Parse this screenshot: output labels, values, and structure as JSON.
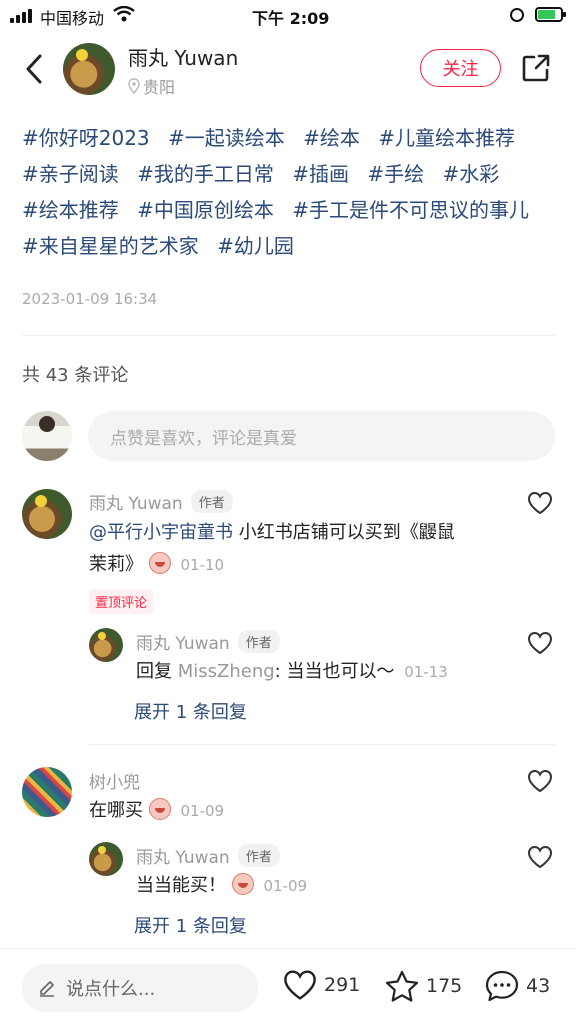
{
  "status_bar": {
    "carrier": "中国移动",
    "time": "下午 2:09"
  },
  "header": {
    "author_name": "雨丸 Yuwan",
    "location": "贵阳",
    "follow_label": "关注"
  },
  "post": {
    "tags": [
      "#你好呀2023",
      "#一起读绘本",
      "#绘本",
      "#儿童绘本推荐",
      "#亲子阅读",
      "#我的手工日常",
      "#插画",
      "#手绘",
      "#水彩",
      "#绘本推荐",
      "#中国原创绘本",
      "#手工是件不可思议的事儿",
      "#来自星星的艺术家",
      "#幼儿园"
    ],
    "date": "2023-01-09 16:34"
  },
  "comments_section": {
    "count_label": "共 43 条评论",
    "input_placeholder": "点赞是喜欢，评论是真爱",
    "comments": [
      {
        "name": "雨丸 Yuwan",
        "badge": "作者",
        "mention": "@平行小宇宙童书",
        "text_line1": " 小红书店铺可以买到《鼹鼠",
        "text_line2": "茉莉》",
        "date": "01-10",
        "pin_label": "置顶评论",
        "reply": {
          "name": "雨丸 Yuwan",
          "badge": "作者",
          "prefix": "回复 ",
          "reply_to": "MissZheng",
          "text": ": 当当也可以～",
          "date": "01-13"
        },
        "expand_label": "展开 1 条回复"
      },
      {
        "name": "树小兜",
        "text": "在哪买",
        "date": "01-09",
        "reply": {
          "name": "雨丸 Yuwan",
          "badge": "作者",
          "text": "当当能买！",
          "date": "01-09"
        },
        "expand_label": "展开 1 条回复"
      }
    ]
  },
  "bottom_bar": {
    "input_placeholder": "说点什么...",
    "likes": "291",
    "collects": "175",
    "comments": "43"
  },
  "colors": {
    "accent": "#ff2442",
    "tag_blue": "#2b4a78",
    "battery_green": "#34c759"
  },
  "icons": [
    "signal-icon",
    "wifi-icon",
    "orientation-lock-icon",
    "battery-icon",
    "back-icon",
    "location-icon",
    "share-icon",
    "heart-icon",
    "star-icon",
    "comment-icon",
    "pencil-icon"
  ]
}
